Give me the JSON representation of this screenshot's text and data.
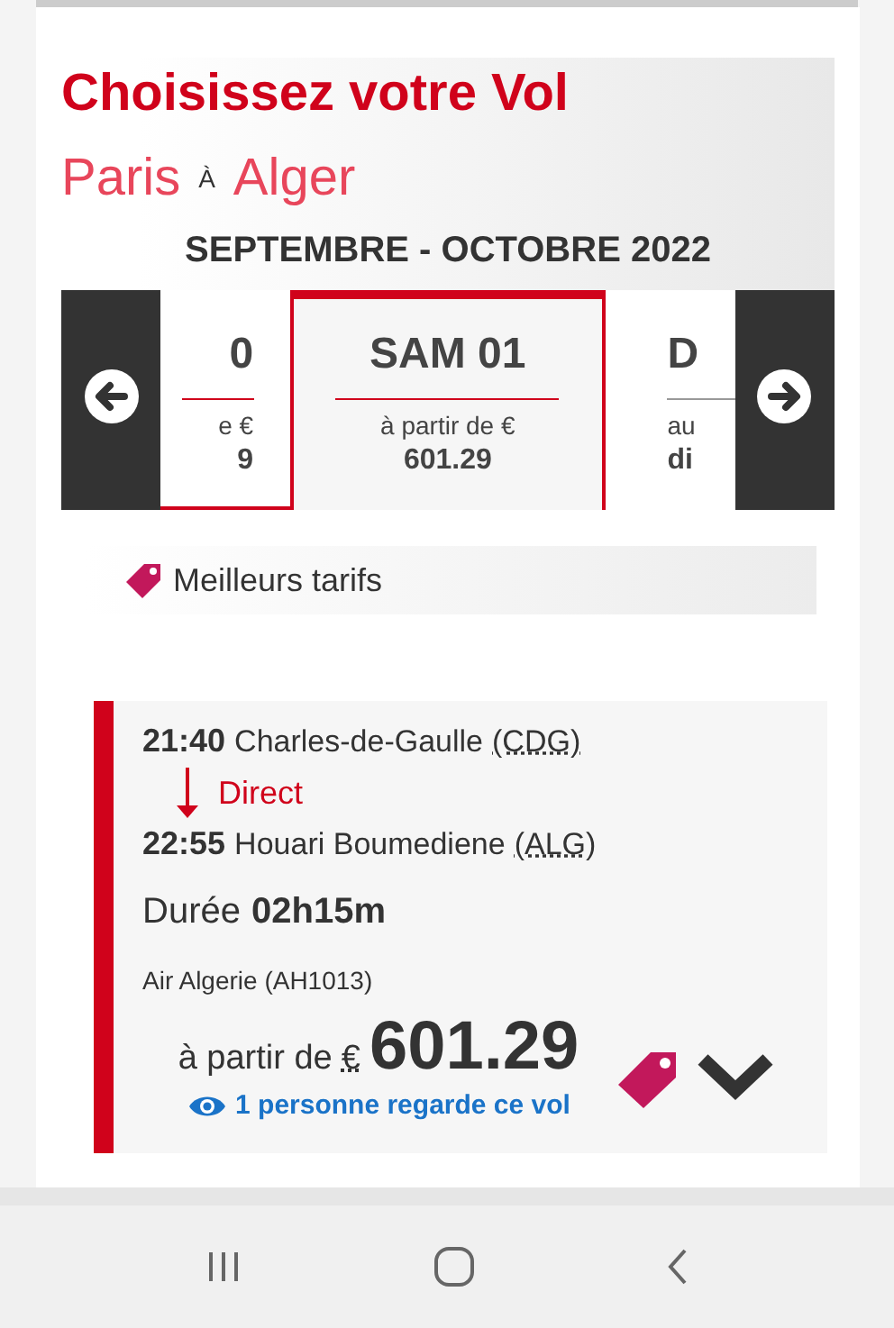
{
  "header": {
    "title": "Choisissez votre Vol",
    "origin": "Paris",
    "connector": "À",
    "destination": "Alger",
    "period": "SEPTEMBRE - OCTOBRE 2022"
  },
  "dates": [
    {
      "day": "0",
      "label": "e €",
      "price": "9",
      "selected": false,
      "kind": "left"
    },
    {
      "day": "SAM 01",
      "label": "à partir de €",
      "price": "601.29",
      "selected": true,
      "kind": "center"
    },
    {
      "day": "D",
      "label": "au",
      "price": "di",
      "selected": false,
      "kind": "right"
    }
  ],
  "best_fares": "Meilleurs tarifs",
  "flight": {
    "depart_time": "21:40",
    "depart_airport": "Charles-de-Gaulle",
    "depart_code": "(CDG)",
    "stop": "Direct",
    "arrive_time": "22:55",
    "arrive_airport": "Houari Boumediene",
    "arrive_code": "(ALG)",
    "duration_label": "Durée",
    "duration": "02h15m",
    "airline": "Air Algerie (AH1013)",
    "price_prefix": "à partir de",
    "currency": "€",
    "price": "601.29",
    "watchers": "1 personne regarde ce vol"
  }
}
